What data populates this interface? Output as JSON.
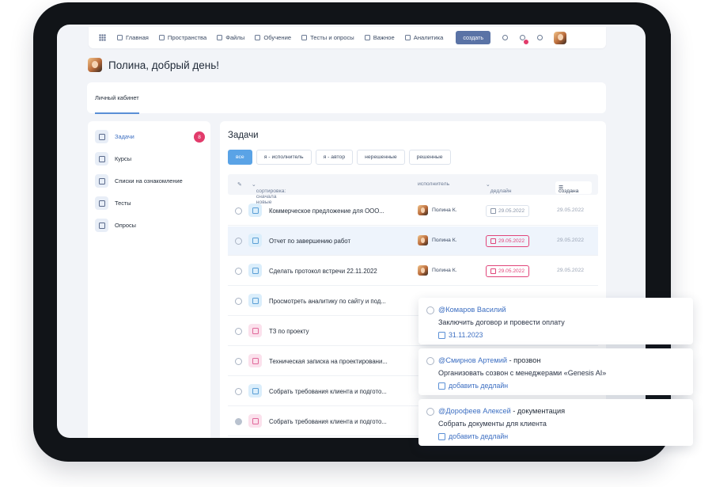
{
  "nav": {
    "items": [
      "Главная",
      "Пространства",
      "Файлы",
      "Обучение",
      "Тесты и опросы",
      "Важное",
      "Аналитика"
    ],
    "create_label": "создать"
  },
  "greeting": "Полина, добрый день!",
  "cabinet_tab": "Личный кабинет",
  "sidebar": {
    "items": [
      {
        "label": "Задачи",
        "badge": "8",
        "icon": "tasks-icon"
      },
      {
        "label": "Курсы",
        "icon": "book-icon"
      },
      {
        "label": "Списки на ознакомление",
        "icon": "clipboard-icon"
      },
      {
        "label": "Тесты",
        "icon": "test-icon"
      },
      {
        "label": "Опросы",
        "icon": "survey-icon"
      }
    ]
  },
  "main": {
    "title": "Задачи",
    "filters": [
      "все",
      "я - исполнитель",
      "я - автор",
      "нерешенные",
      "решенные"
    ],
    "active_filter": "все",
    "table": {
      "sort_label": "сортировка: сначала новые",
      "col_executor": "исполнитель",
      "col_deadline": "дедлайн",
      "col_created": "создана"
    },
    "rows": [
      {
        "title": "Коммерческое предложение для ООО...",
        "executor": "Полина К.",
        "deadline": "29.05.2022",
        "created": "29.05.2022",
        "overdue": false,
        "icon": "blue"
      },
      {
        "title": "Отчет по завершению работ",
        "executor": "Полина К.",
        "deadline": "29.05.2022",
        "created": "29.05.2022",
        "overdue": true,
        "icon": "blue"
      },
      {
        "title": "Сделать протокол встречи 22.11.2022",
        "executor": "Полина К.",
        "deadline": "29.05.2022",
        "created": "29.05.2022",
        "overdue": true,
        "icon": "blue"
      },
      {
        "title": "Просмотреть аналитику по сайту и под...",
        "icon": "blue"
      },
      {
        "title": "ТЗ по проекту",
        "icon": "pink"
      },
      {
        "title": "Техническая записка на проектировани...",
        "icon": "pink"
      },
      {
        "title": "Собрать требования клиента и подгото...",
        "icon": "blue"
      },
      {
        "title": "Собрать требования клиента и подгото...",
        "icon": "pink",
        "done": true
      }
    ]
  },
  "cards": [
    {
      "mention": "@Комаров Василий",
      "suffix": "",
      "text": "Заключить договор и провести оплату",
      "meta": "31.11.2023"
    },
    {
      "mention": "@Смирнов Артемий",
      "suffix": " - прозвон",
      "text": "Организовать созвон с менеджерами «Genesis AI»",
      "meta": "добавить дедлайн"
    },
    {
      "mention": "@Дорофеев Алексей",
      "suffix": " - документация",
      "text": "Собрать документы для клиента",
      "meta": "добавить дедлайн"
    }
  ],
  "colors": {
    "accent": "#5aa3e6",
    "brand": "#5a73a6",
    "overdue": "#e0457a",
    "badge": "#e23b6b"
  }
}
